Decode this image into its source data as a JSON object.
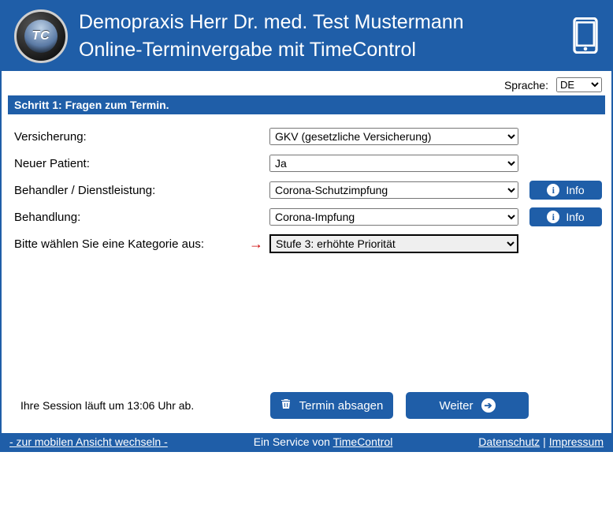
{
  "header": {
    "logo_text": "TC",
    "title1": "Demopraxis Herr Dr. med. Test Mustermann",
    "title2": "Online-Terminvergabe mit TimeControl"
  },
  "language": {
    "label": "Sprache:",
    "selected": "DE"
  },
  "step_title": "Schritt 1: Fragen zum Termin.",
  "fields": {
    "insurance": {
      "label": "Versicherung:",
      "value": "GKV (gesetzliche Versicherung)"
    },
    "new_patient": {
      "label": "Neuer Patient:",
      "value": "Ja"
    },
    "practitioner": {
      "label": "Behandler / Dienstleistung:",
      "value": "Corona-Schutzimpfung",
      "info": "Info"
    },
    "treatment": {
      "label": "Behandlung:",
      "value": "Corona-Impfung",
      "info": "Info"
    },
    "category": {
      "label": "Bitte wählen Sie eine Kategorie aus:",
      "value": "Stufe 3: erhöhte Priorität"
    }
  },
  "session_text": "Ihre Session läuft um 13:06 Uhr ab.",
  "buttons": {
    "cancel": "Termin absagen",
    "next": "Weiter"
  },
  "footer": {
    "mobile": "- zur mobilen Ansicht wechseln -",
    "service_prefix": "Ein Service von ",
    "service_link": "TimeControl",
    "privacy": "Datenschutz",
    "imprint": "Impressum"
  }
}
